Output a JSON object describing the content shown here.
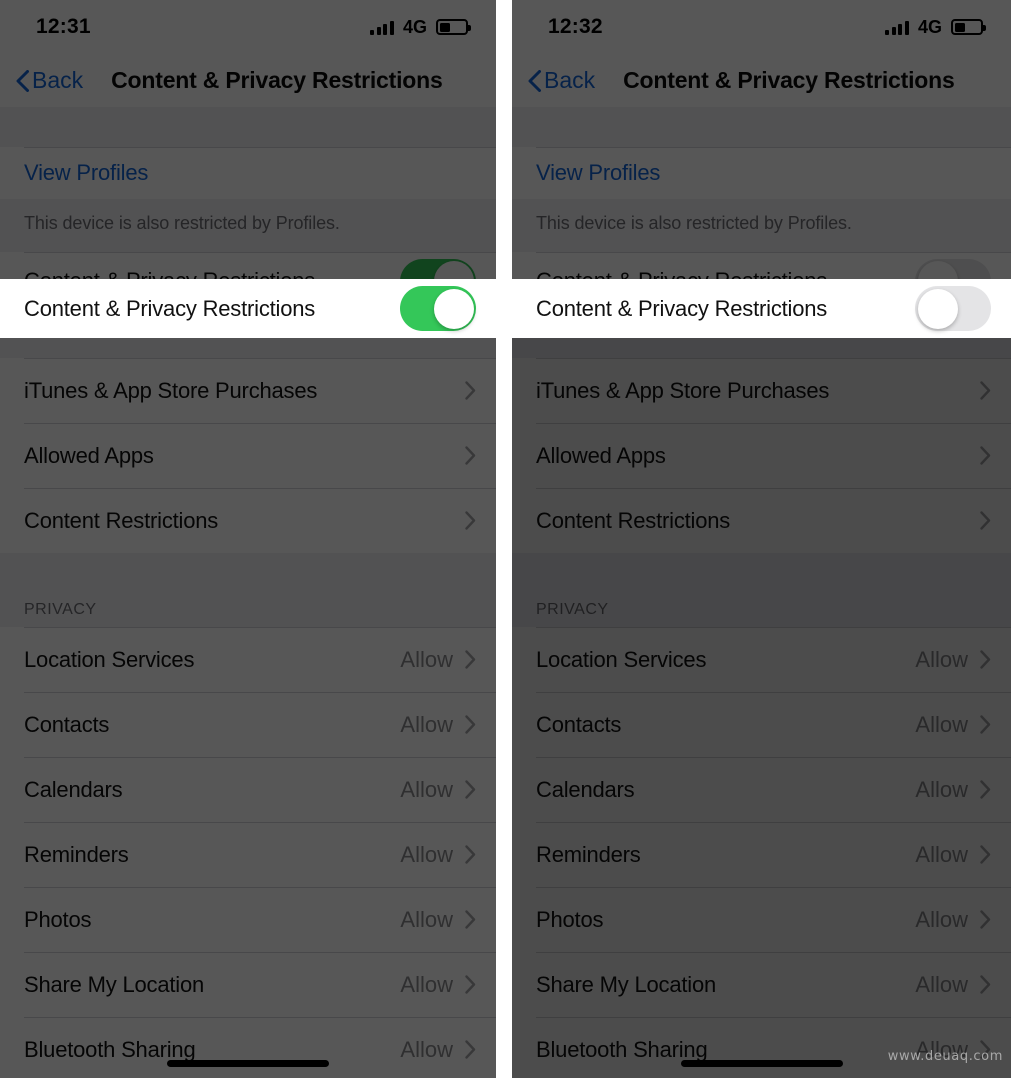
{
  "panels": [
    {
      "id": "left",
      "status": {
        "time": "12:31",
        "network": "4G",
        "signal_bars": 4,
        "battery_percent": 35
      },
      "nav": {
        "back_label": "Back",
        "title": "Content & Privacy Restrictions"
      },
      "profiles": {
        "link_label": "View Profiles",
        "footnote": "This device is also restricted by Profiles."
      },
      "highlight": {
        "label": "Content & Privacy Restrictions",
        "toggle_state": "on"
      },
      "restrictions": [
        {
          "label": "iTunes & App Store Purchases"
        },
        {
          "label": "Allowed Apps"
        },
        {
          "label": "Content Restrictions"
        }
      ],
      "privacy_header": "PRIVACY",
      "privacy": [
        {
          "label": "Location Services",
          "value": "Allow"
        },
        {
          "label": "Contacts",
          "value": "Allow"
        },
        {
          "label": "Calendars",
          "value": "Allow"
        },
        {
          "label": "Reminders",
          "value": "Allow"
        },
        {
          "label": "Photos",
          "value": "Allow"
        },
        {
          "label": "Share My Location",
          "value": "Allow"
        },
        {
          "label": "Bluetooth Sharing",
          "value": "Allow"
        }
      ]
    },
    {
      "id": "right",
      "status": {
        "time": "12:32",
        "network": "4G",
        "signal_bars": 4,
        "battery_percent": 35
      },
      "nav": {
        "back_label": "Back",
        "title": "Content & Privacy Restrictions"
      },
      "profiles": {
        "link_label": "View Profiles",
        "footnote": "This device is also restricted by Profiles."
      },
      "highlight": {
        "label": "Content & Privacy Restrictions",
        "toggle_state": "off"
      },
      "restrictions": [
        {
          "label": "iTunes & App Store Purchases"
        },
        {
          "label": "Allowed Apps"
        },
        {
          "label": "Content Restrictions"
        }
      ],
      "privacy_header": "PRIVACY",
      "privacy": [
        {
          "label": "Location Services",
          "value": "Allow"
        },
        {
          "label": "Contacts",
          "value": "Allow"
        },
        {
          "label": "Calendars",
          "value": "Allow"
        },
        {
          "label": "Reminders",
          "value": "Allow"
        },
        {
          "label": "Photos",
          "value": "Allow"
        },
        {
          "label": "Share My Location",
          "value": "Allow"
        },
        {
          "label": "Bluetooth Sharing",
          "value": "Allow"
        }
      ]
    }
  ],
  "watermark": "www.deuaq.com",
  "colors": {
    "accent_link": "#1464d6",
    "toggle_on": "#34C759",
    "toggle_off": "#E4E4E6",
    "group_bg": "#EFEFF4",
    "row_bg": "#FFFFFF",
    "secondary_text": "#8A8A8E"
  }
}
